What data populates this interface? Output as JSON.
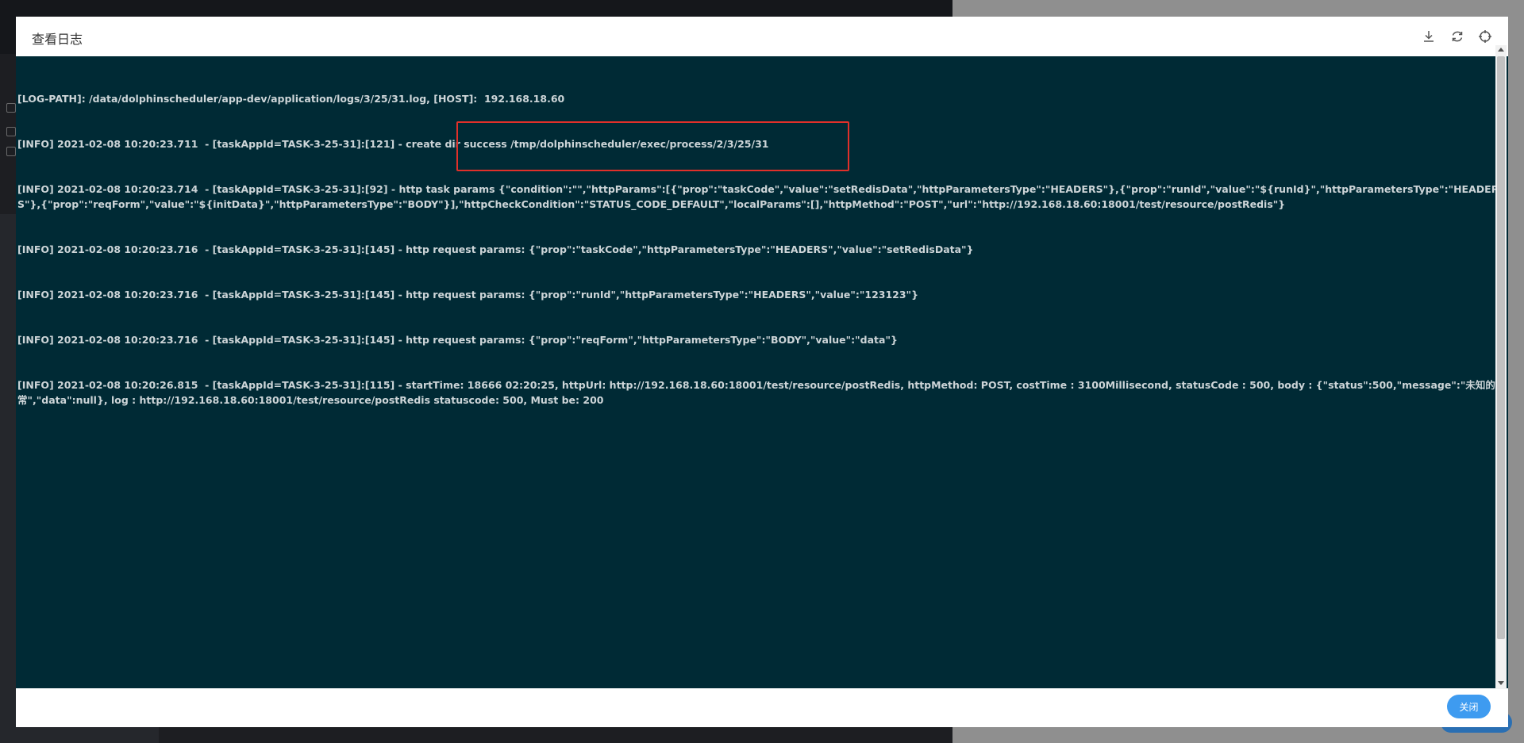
{
  "modal": {
    "title": "查看日志",
    "close_label": "关闭",
    "header_icons": [
      "download-icon",
      "refresh-icon",
      "fullscreen-icon"
    ]
  },
  "log": {
    "lines": [
      "[LOG-PATH]: /data/dolphinscheduler/app-dev/application/logs/3/25/31.log, [HOST]:  192.168.18.60",
      "[INFO] 2021-02-08 10:20:23.711  - [taskAppId=TASK-3-25-31]:[121] - create dir success /tmp/dolphinscheduler/exec/process/2/3/25/31",
      "[INFO] 2021-02-08 10:20:23.714  - [taskAppId=TASK-3-25-31]:[92] - http task params {\"condition\":\"\",\"httpParams\":[{\"prop\":\"taskCode\",\"value\":\"setRedisData\",\"httpParametersType\":\"HEADERS\"},{\"prop\":\"runId\",\"value\":\"${runId}\",\"httpParametersType\":\"HEADERS\"},{\"prop\":\"reqForm\",\"value\":\"${initData}\",\"httpParametersType\":\"BODY\"}],\"httpCheckCondition\":\"STATUS_CODE_DEFAULT\",\"localParams\":[],\"httpMethod\":\"POST\",\"url\":\"http://192.168.18.60:18001/test/resource/postRedis\"}",
      "[INFO] 2021-02-08 10:20:23.716  - [taskAppId=TASK-3-25-31]:[145] - http request params: {\"prop\":\"taskCode\",\"httpParametersType\":\"HEADERS\",\"value\":\"setRedisData\"}",
      "[INFO] 2021-02-08 10:20:23.716  - [taskAppId=TASK-3-25-31]:[145] - http request params: {\"prop\":\"runId\",\"httpParametersType\":\"HEADERS\",\"value\":\"123123\"}",
      "[INFO] 2021-02-08 10:20:23.716  - [taskAppId=TASK-3-25-31]:[145] - http request params: {\"prop\":\"reqForm\",\"httpParametersType\":\"BODY\",\"value\":\"data\"}",
      "[INFO] 2021-02-08 10:20:26.815  - [taskAppId=TASK-3-25-31]:[115] - startTime: 18666 02:20:25, httpUrl: http://192.168.18.60:18001/test/resource/postRedis, httpMethod: POST, costTime : 3100Millisecond, statusCode : 500, body : {\"status\":500,\"message\":\"未知的异常\",\"data\":null}, log : http://192.168.18.60:18001/test/resource/postRedis statuscode: 500, Must be: 200"
    ]
  },
  "colors": {
    "log_background": "#002a35",
    "log_text": "#cdd5d8",
    "highlight_border": "#e0302a",
    "close_button": "#3e9bf0"
  }
}
